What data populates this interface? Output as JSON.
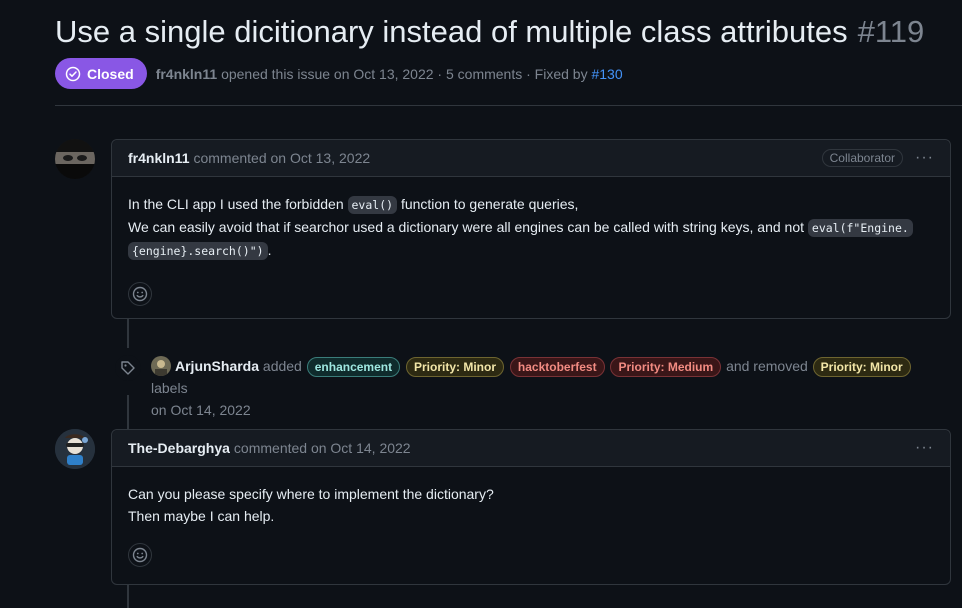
{
  "issue": {
    "title": "Use a single dicitionary instead of multiple class attributes",
    "number": "#119",
    "state": "Closed",
    "author": "fr4nkln11",
    "opened_text": "opened this issue on Oct 13, 2022 · 5 comments · Fixed by",
    "fixed_by": "#130"
  },
  "comments": [
    {
      "author": "fr4nkln11",
      "meta": "commented on Oct 13, 2022",
      "badge": "Collaborator",
      "menu": "···",
      "line1_pre": "In the CLI app I used the forbidden",
      "line1_code": "eval()",
      "line1_post": "function to generate queries,",
      "line2_pre": "We can easily avoid that if searchor used a dictionary were all engines can be called with string keys, and not",
      "line2_code_a": "eval(f\"Engine.",
      "line2_code_b": "{engine}.search()\")",
      "line2_post": ".",
      "reaction_icon": "smiley-icon"
    },
    {
      "author": "The-Debarghya",
      "meta": "commented on Oct 14, 2022",
      "menu": "···",
      "line1": "Can you please specify where to implement the dictionary?",
      "line2": "Then maybe I can help.",
      "reaction_icon": "smiley-icon"
    }
  ],
  "label_event": {
    "icon": "tag-icon",
    "actor": "ArjunSharda",
    "added_text": "added",
    "added_labels": [
      "enhancement",
      "Priority: Minor",
      "hacktoberfest",
      "Priority: Medium"
    ],
    "removed_text": "and removed",
    "removed_labels": [
      "Priority: Minor"
    ],
    "suffix": "labels",
    "date": "on Oct 14, 2022"
  },
  "colors": {
    "background": "#0d1117",
    "closed_badge": "#8957e5",
    "link": "#4493f8"
  }
}
